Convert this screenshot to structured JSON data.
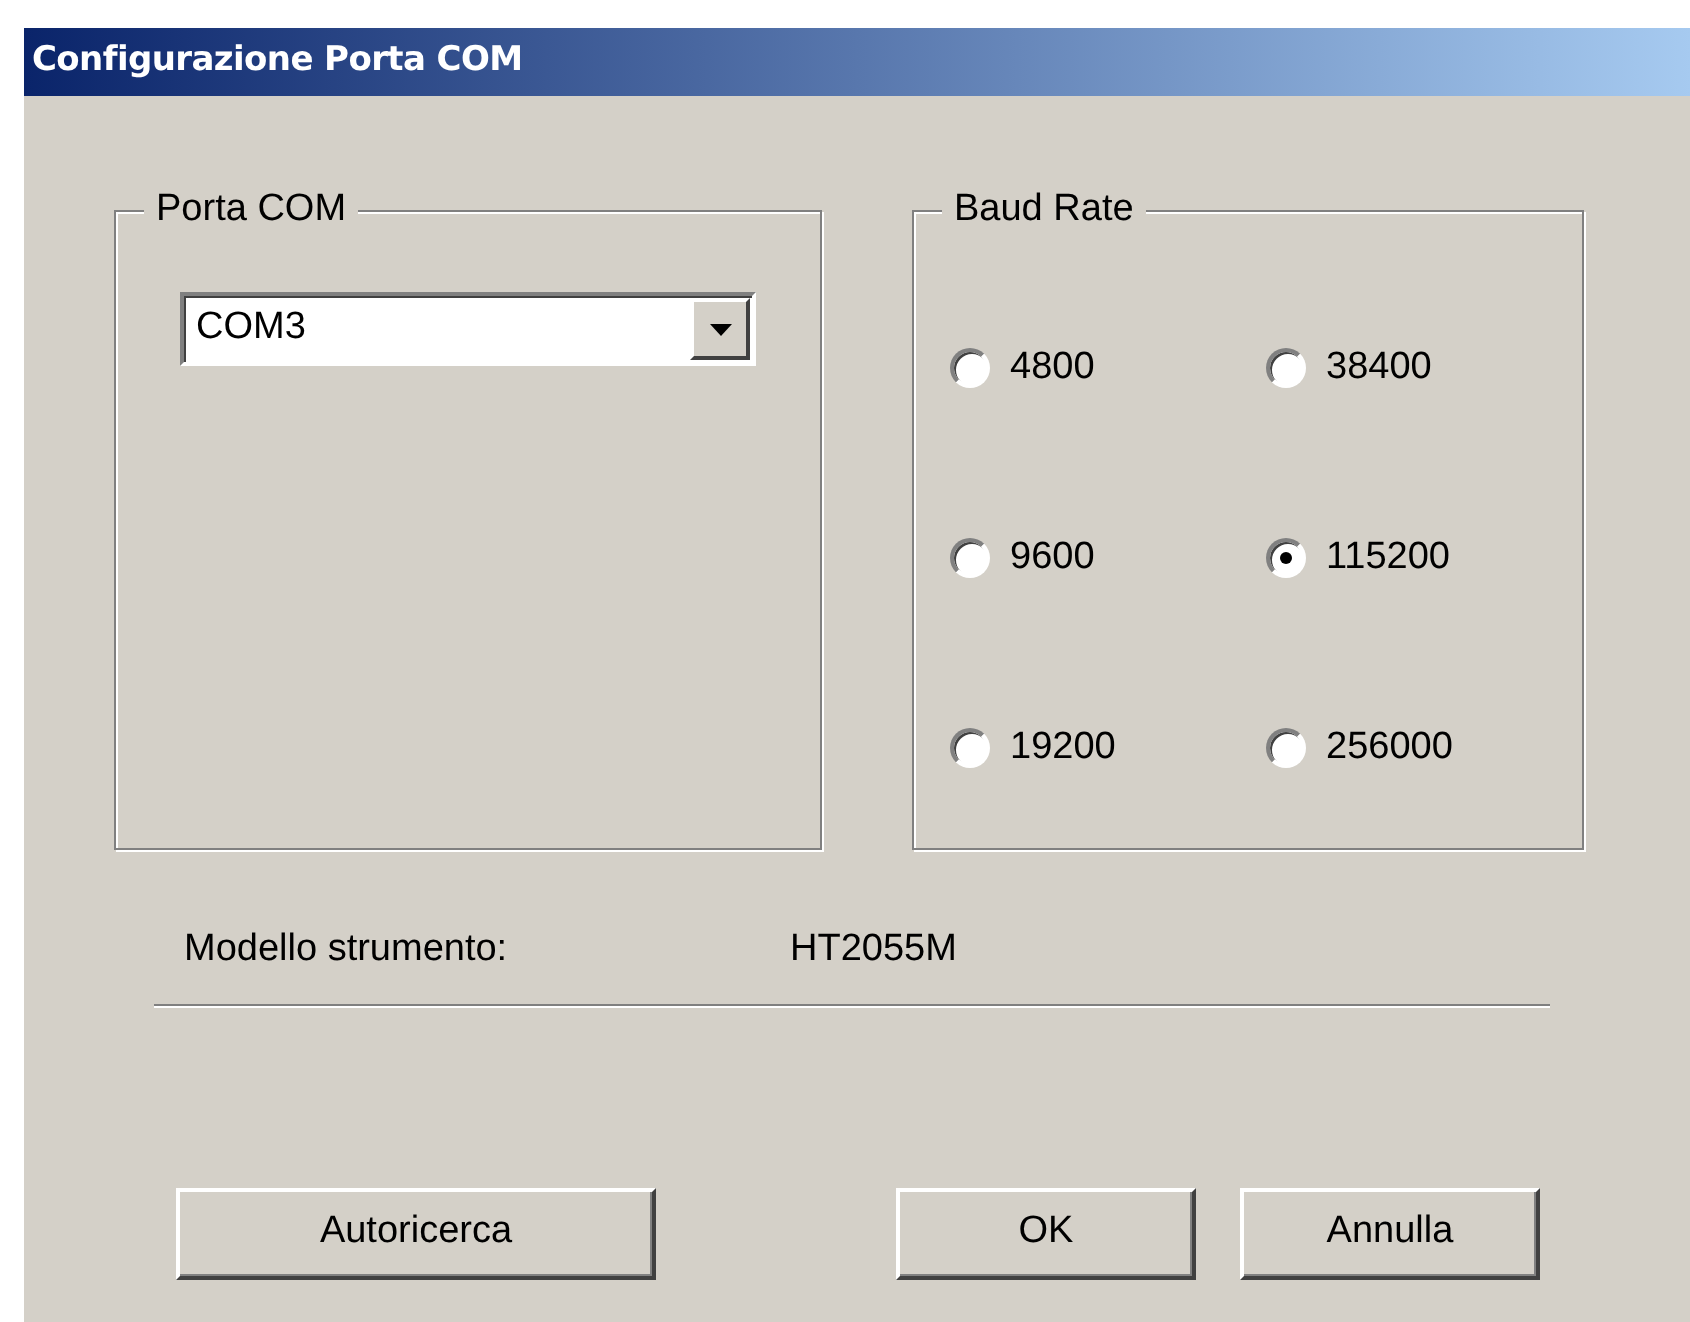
{
  "window": {
    "title": "Configurazione Porta COM"
  },
  "port_group": {
    "title": "Porta COM",
    "combo": {
      "value": "COM3"
    }
  },
  "baud_group": {
    "title": "Baud Rate",
    "options": [
      {
        "label": "4800",
        "selected": false
      },
      {
        "label": "38400",
        "selected": false
      },
      {
        "label": "9600",
        "selected": false
      },
      {
        "label": "115200",
        "selected": true
      },
      {
        "label": "19200",
        "selected": false
      },
      {
        "label": "256000",
        "selected": false
      }
    ]
  },
  "model": {
    "label": "Modello strumento:",
    "value": "HT2055M"
  },
  "buttons": [
    {
      "label": "Autoricerca",
      "kind": "wide"
    },
    {
      "label": "OK",
      "kind": "normal"
    },
    {
      "label": "Annulla",
      "kind": "normal"
    }
  ]
}
